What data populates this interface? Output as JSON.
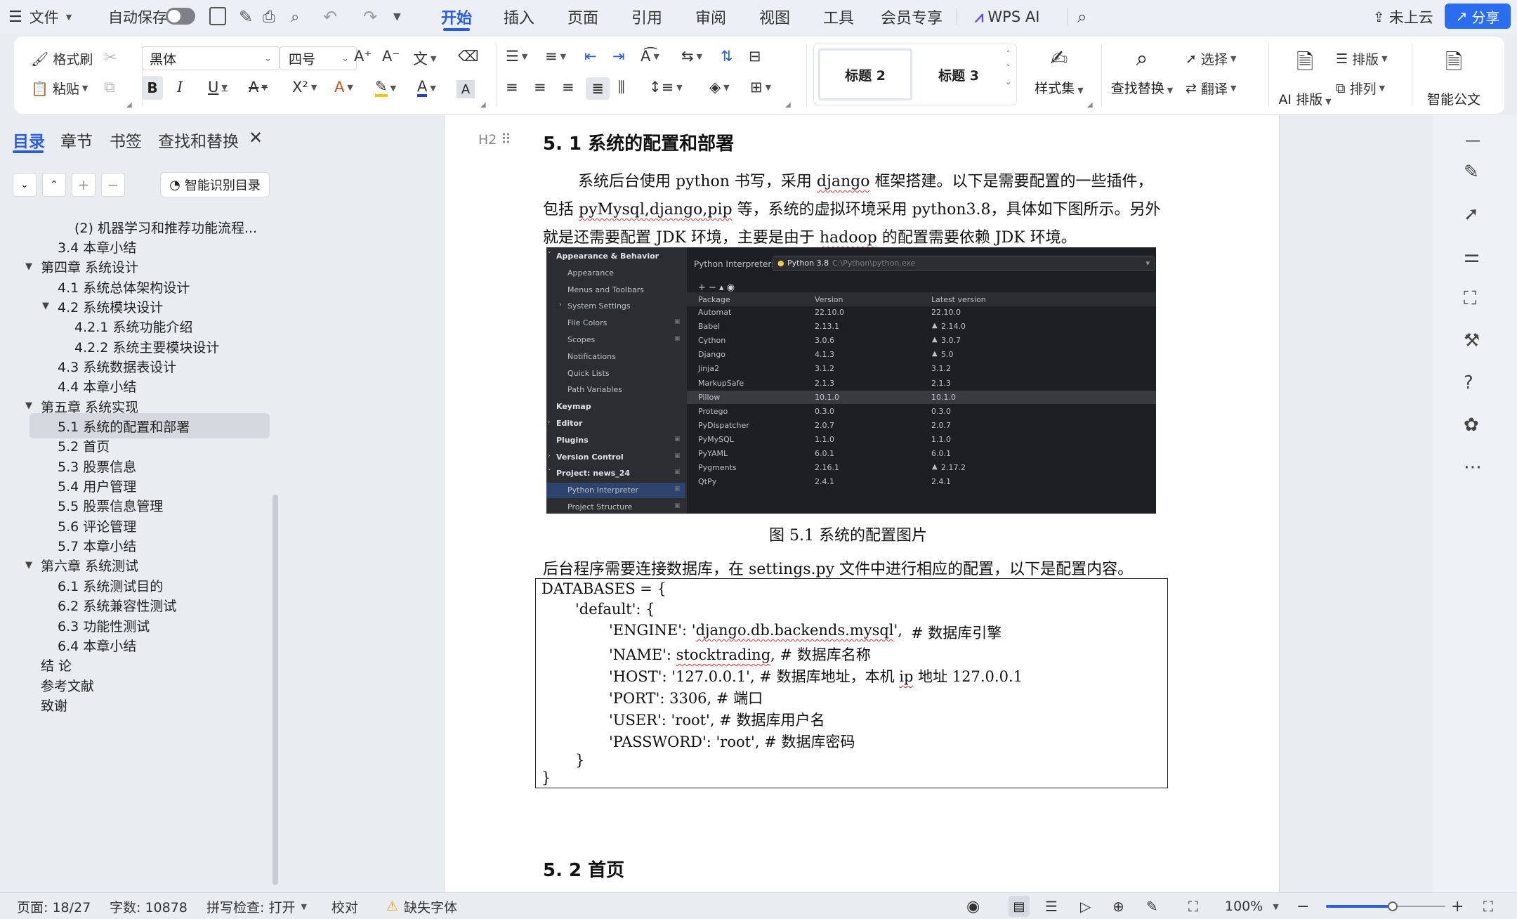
{
  "titlebar": {
    "file_menu": "文件",
    "autosave_label": "自动保存",
    "tabs": [
      "开始",
      "插入",
      "页面",
      "引用",
      "审阅",
      "视图",
      "工具",
      "会员专享"
    ],
    "wps_ai": "WPS AI",
    "cloud_status": "未上云",
    "share_button": "分享"
  },
  "ribbon": {
    "format_painter": "格式刷",
    "paste": "粘贴",
    "font_name": "黑体",
    "font_size": "四号",
    "style_heading2": "标题 2",
    "style_heading3": "标题 3",
    "style_set": "样式集",
    "find_replace": "查找替换",
    "select": "选择",
    "translate": "翻译",
    "ai_layout": "AI 排版",
    "typeset": "排版",
    "arrange": "排列",
    "smart_doc": "智能公文",
    "colors": {
      "font_color": "#1f3fd6",
      "highlight": "#f0c419",
      "accent": "#2b5cdb"
    }
  },
  "leftpanel": {
    "tabs": [
      "目录",
      "章节",
      "书签",
      "查找和替换"
    ],
    "smart_toc_button": "智能识别目录",
    "toc": [
      {
        "text": "(2) 机器学习和推荐功能流程...",
        "level": 3
      },
      {
        "text": "3.4 本章小结",
        "level": 2
      },
      {
        "text": "第四章  系统设计",
        "level": 1,
        "expanded": true
      },
      {
        "text": "4.1  系统总体架构设计",
        "level": 2
      },
      {
        "text": "4.2  系统模块设计",
        "level": 2,
        "expanded": true
      },
      {
        "text": "4.2.1 系统功能介绍",
        "level": 3
      },
      {
        "text": "4.2.2 系统主要模块设计",
        "level": 3
      },
      {
        "text": "4.3  系统数据表设计",
        "level": 2
      },
      {
        "text": "4.4  本章小结",
        "level": 2
      },
      {
        "text": "第五章  系统实现",
        "level": 1,
        "expanded": true
      },
      {
        "text": "5.1  系统的配置和部署",
        "level": 2,
        "selected": true
      },
      {
        "text": "5.2  首页",
        "level": 2
      },
      {
        "text": "5.3  股票信息",
        "level": 2
      },
      {
        "text": "5.4  用户管理",
        "level": 2
      },
      {
        "text": "5.5  股票信息管理",
        "level": 2
      },
      {
        "text": "5.6  评论管理",
        "level": 2
      },
      {
        "text": "5.7 本章小结",
        "level": 2
      },
      {
        "text": "第六章  系统测试",
        "level": 1,
        "expanded": true
      },
      {
        "text": "6.1  系统测试目的",
        "level": 2
      },
      {
        "text": "6.2  系统兼容性测试",
        "level": 2
      },
      {
        "text": "6.3  功能性测试",
        "level": 2
      },
      {
        "text": "6.4  本章小结",
        "level": 2
      },
      {
        "text": "结   论",
        "level": 1
      },
      {
        "text": "参考文献",
        "level": 1
      },
      {
        "text": "致谢",
        "level": 1
      }
    ]
  },
  "document": {
    "heading_marker": "H2",
    "heading_5_1": "5. 1  系统的配置和部署",
    "para1_line1_a": "系统后台使用 python 书写，采用 ",
    "para1_line1_b": "django",
    "para1_line1_c": " 框架搭建。以下是需要配置的一些插件，",
    "para1_line2_a": "包括 ",
    "para1_line2_b": "pyMysql,django,pip",
    "para1_line2_c": " 等，系统的虚拟环境采用 python3.8，具体如下图所示。另外",
    "para1_line3_a": "就是还需要配置 JDK 环境，主要是由于 ",
    "para1_line3_b": "hadoop",
    "para1_line3_c": " 的配置需要依赖 JDK 环境。",
    "figure_caption": "图 5.1 系统的配置图片",
    "para2": "后台程序需要连接数据库，在 settings.py 文件中进行相应的配置，以下是配置内容。",
    "code": {
      "l1": "DATABASES = {",
      "l2": "'default': {",
      "l3a": "'ENGINE': '",
      "l3b": "django.db.backends.mysql",
      "l3c": "',",
      "l3d": "#  数据库引擎",
      "l4a": "'NAME': ",
      "l4b": "stocktrading",
      "l4c": ", #  数据库名称",
      "l5a": "'HOST': '127.0.0.1', #  数据库地址，本机  ",
      "l5b": "ip",
      "l5c": "  地址  127.0.0.1",
      "l6": "'PORT': 3306, #  端口",
      "l7": "'USER': 'root',   #  数据库用户名",
      "l8": "'PASSWORD': 'root', #  数据库密码",
      "l9": "}",
      "l10": "}"
    },
    "heading_5_2": "5. 2  首页"
  },
  "ide": {
    "sidebar": [
      {
        "text": "Appearance & Behavior",
        "bold": true,
        "arrow": "down"
      },
      {
        "text": "Appearance",
        "indent": 1
      },
      {
        "text": "Menus and Toolbars",
        "indent": 1
      },
      {
        "text": "System Settings",
        "indent": 1,
        "arrow": "right"
      },
      {
        "text": "File Colors",
        "indent": 1,
        "marker": true
      },
      {
        "text": "Scopes",
        "indent": 1,
        "marker": true
      },
      {
        "text": "Notifications",
        "indent": 1
      },
      {
        "text": "Quick Lists",
        "indent": 1
      },
      {
        "text": "Path Variables",
        "indent": 1
      },
      {
        "text": "Keymap",
        "bold": true
      },
      {
        "text": "Editor",
        "bold": true,
        "arrow": "right"
      },
      {
        "text": "Plugins",
        "bold": true,
        "marker": true
      },
      {
        "text": "Version Control",
        "bold": true,
        "arrow": "right",
        "marker": true
      },
      {
        "text": "Project: news_24",
        "bold": true,
        "arrow": "down",
        "marker": true
      },
      {
        "text": "Python Interpreter",
        "indent": 1,
        "selected": true,
        "marker": true
      },
      {
        "text": "Project Structure",
        "indent": 1,
        "marker": true
      }
    ],
    "interpreter_label": "Python Interpreter:",
    "interpreter_value": "Python 3.8",
    "interpreter_path": "C:\\Python\\python.exe",
    "columns": [
      "Package",
      "Version",
      "Latest version"
    ],
    "packages": [
      {
        "name": "Automat",
        "version": "22.10.0",
        "latest": "22.10.0",
        "up": false
      },
      {
        "name": "Babel",
        "version": "2.13.1",
        "latest": "2.14.0",
        "up": true
      },
      {
        "name": "Cython",
        "version": "3.0.6",
        "latest": "3.0.7",
        "up": true
      },
      {
        "name": "Django",
        "version": "4.1.3",
        "latest": "5.0",
        "up": true
      },
      {
        "name": "Jinja2",
        "version": "3.1.2",
        "latest": "3.1.2",
        "up": false
      },
      {
        "name": "MarkupSafe",
        "version": "2.1.3",
        "latest": "2.1.3",
        "up": false
      },
      {
        "name": "Pillow",
        "version": "10.1.0",
        "latest": "10.1.0",
        "up": false,
        "selected": true
      },
      {
        "name": "Protego",
        "version": "0.3.0",
        "latest": "0.3.0",
        "up": false
      },
      {
        "name": "PyDispatcher",
        "version": "2.0.7",
        "latest": "2.0.7",
        "up": false
      },
      {
        "name": "PyMySQL",
        "version": "1.1.0",
        "latest": "1.1.0",
        "up": false
      },
      {
        "name": "PyYAML",
        "version": "6.0.1",
        "latest": "6.0.1",
        "up": false
      },
      {
        "name": "Pygments",
        "version": "2.16.1",
        "latest": "2.17.2",
        "up": true
      },
      {
        "name": "QtPy",
        "version": "2.4.1",
        "latest": "2.4.1",
        "up": false
      }
    ]
  },
  "statusbar": {
    "page": "页面: 18/27",
    "word_count": "字数: 10878",
    "spellcheck": "拼写检查: 打开",
    "proofread": "校对",
    "missing_font": "缺失字体",
    "zoom": "100%",
    "zoom_level": 0.56
  }
}
